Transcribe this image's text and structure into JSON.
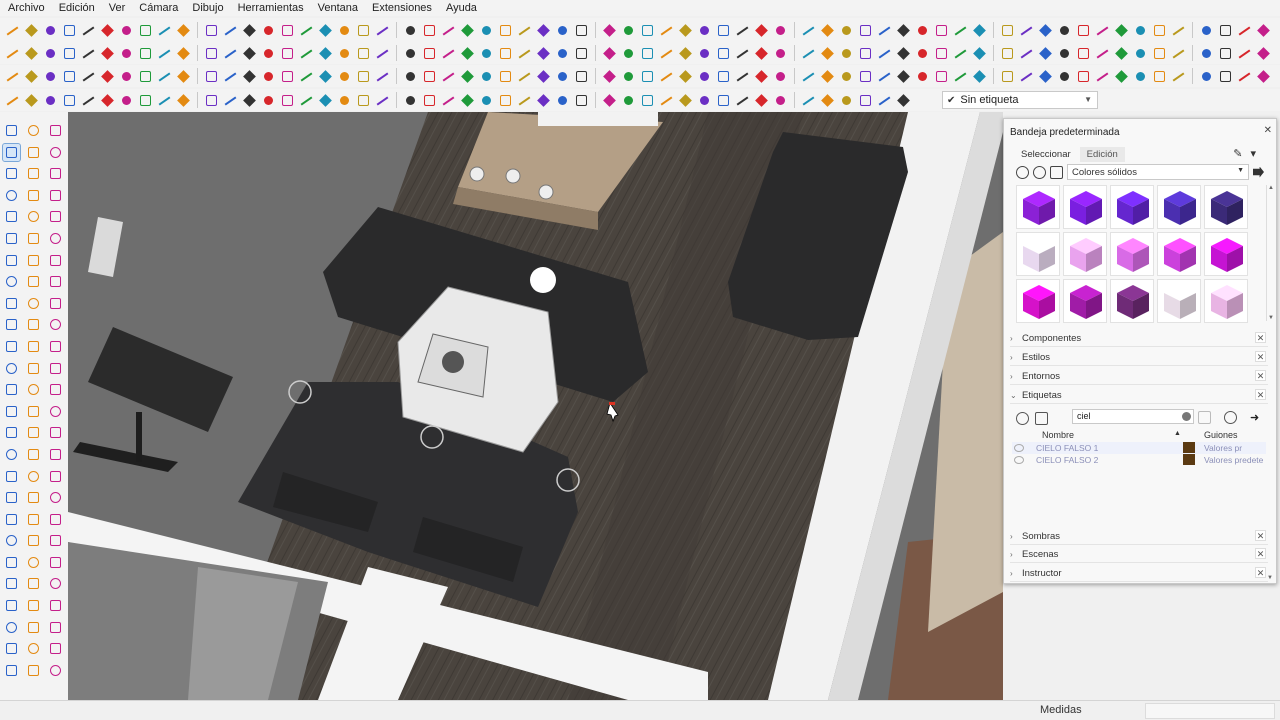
{
  "menu": [
    "Archivo",
    "Edición",
    "Ver",
    "Cámara",
    "Dibujo",
    "Herramientas",
    "Ventana",
    "Extensiones",
    "Ayuda"
  ],
  "toolbar": {
    "tag_select_value": "Sin etiqueta"
  },
  "tray": {
    "title": "Bandeja predeterminada",
    "tabs": [
      "Seleccionar",
      "Edición"
    ],
    "materials": {
      "collection": "Colores sólidos",
      "swatches": [
        "#8b21d6",
        "#7a1fe0",
        "#6526cf",
        "#4b2fb0",
        "#3b2a78",
        "#e8d8ef",
        "#e9a3ee",
        "#d86be6",
        "#cb41dc",
        "#c514d3",
        "#d512c9",
        "#a01ca7",
        "#6f2b77",
        "#e7dbe6",
        "#e8b4e3"
      ]
    },
    "sections": {
      "components": "Componentes",
      "styles": "Estilos",
      "environments": "Entornos",
      "tags": "Etiquetas",
      "shadows": "Sombras",
      "scenes": "Escenas",
      "instructor": "Instructor"
    },
    "tags_panel": {
      "search_value": "ciel",
      "col_name": "Nombre",
      "col_dash": "Guiones",
      "rows": [
        {
          "name": "CIELO FALSO 1",
          "color": "#5b3a12",
          "dash": "Valores pr"
        },
        {
          "name": "CIELO FALSO 2",
          "color": "#5b3a12",
          "dash": "Valores predete"
        }
      ]
    }
  },
  "status": {
    "measure_label": "Medidas",
    "measure_value": ""
  }
}
